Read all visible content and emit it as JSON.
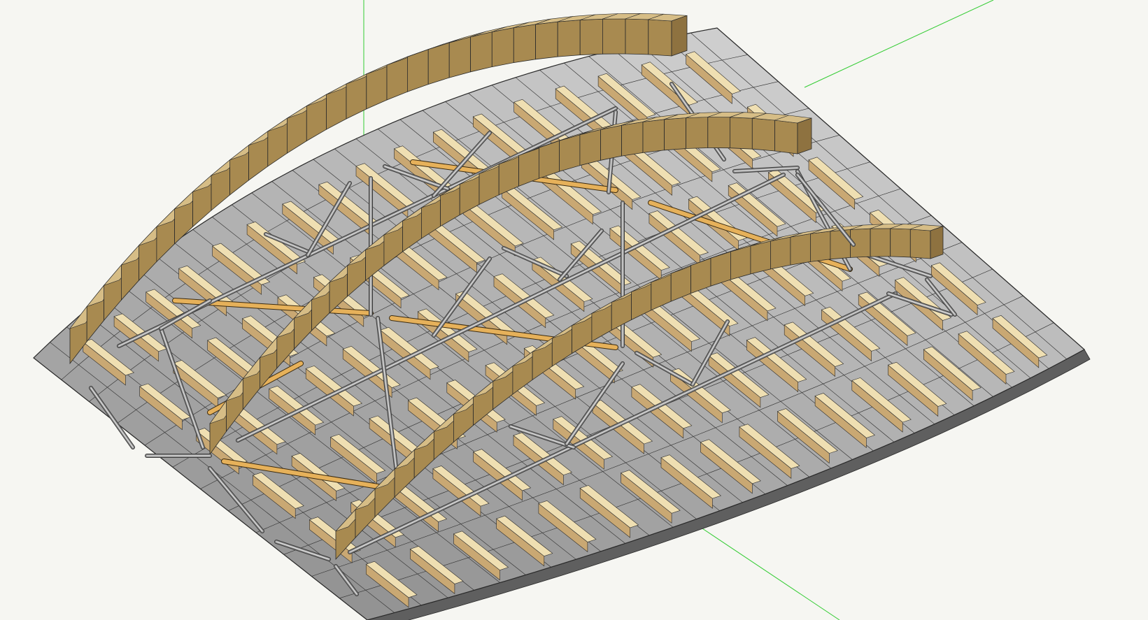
{
  "viewport": {
    "kind": "3d-model-viewport",
    "background": "#f6f6f2",
    "axis_color": "#33cc33"
  },
  "model": {
    "subject": "curved-roof-with-arched-ribs-and-steel-truss-bracing",
    "colors": {
      "roof_tile_light": "#c8c8c8",
      "roof_tile_dark": "#7c7c7c",
      "rib_face": "#a88a50",
      "rib_top": "#d6bd86",
      "purlin_face": "#efdfb2",
      "purlin_side": "#c9a873",
      "rod": "#8c8c8c",
      "rod_highlight": "#e6e6e6",
      "timber_brace": "#e6b15a",
      "edge": "#2a2a2a"
    },
    "arch_count": 3,
    "purlin_count": 17,
    "tile_columns": 32,
    "tile_rows": 12
  }
}
